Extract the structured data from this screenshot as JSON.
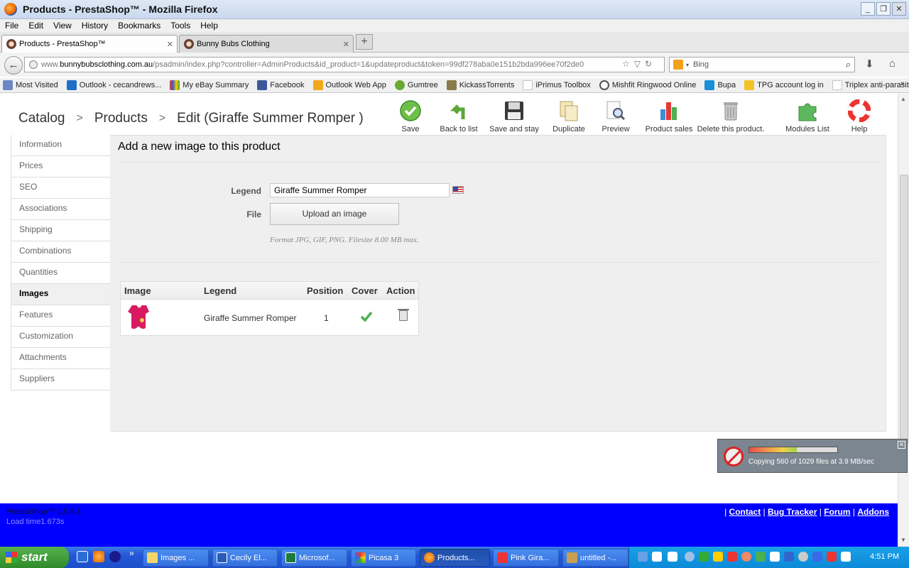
{
  "window": {
    "title": "Products - PrestaShop™ - Mozilla Firefox",
    "minimize": "_",
    "maximize": "❐",
    "close": "✕"
  },
  "menu": [
    "File",
    "Edit",
    "View",
    "History",
    "Bookmarks",
    "Tools",
    "Help"
  ],
  "tabs": [
    {
      "label": "Products - PrestaShop™",
      "active": true
    },
    {
      "label": "Bunny Bubs Clothing",
      "active": false
    }
  ],
  "new_tab": "+",
  "url": {
    "prefix": "www.",
    "domain": "bunnybubsclothing.com.au",
    "path": "/psadmin/index.php?controller=AdminProducts&id_product=1&updateproduct&token=99df278aba0e151b2bda996ee70f2de0"
  },
  "search": {
    "engine": "Bing"
  },
  "bookmarks": [
    "Most Visited",
    "Outlook - cecandrews...",
    "My eBay Summary",
    "Facebook",
    "Outlook Web App",
    "Gumtree",
    "KickassTorrents",
    "iPrimus Toolbox",
    "Mishfit Ringwood Online",
    "Bupa",
    "TPG account log in",
    "Triplex anti-parasite ti..."
  ],
  "breadcrumb": {
    "catalog": "Catalog",
    "products": "Products",
    "edit": "Edit (Giraffe Summer Romper )",
    "sep": ">"
  },
  "toolbar": [
    "Save",
    "Back to list",
    "Save and stay",
    "Duplicate",
    "Preview",
    "Product sales",
    "Delete this product.",
    "Modules List",
    "Help"
  ],
  "sidebar": [
    "Information",
    "Prices",
    "SEO",
    "Associations",
    "Shipping",
    "Combinations",
    "Quantities",
    "Images",
    "Features",
    "Customization",
    "Attachments",
    "Suppliers"
  ],
  "sidebar_active": "Images",
  "content": {
    "title": "Add a new image to this product",
    "legend_label": "Legend",
    "legend_value": "Giraffe Summer Romper",
    "file_label": "File",
    "upload_button": "Upload an image",
    "format_note": "Format JPG, GIF, PNG. Filesize 8.00 MB max."
  },
  "images_table": {
    "headers": [
      "Image",
      "Legend",
      "Position",
      "Cover",
      "Action"
    ],
    "rows": [
      {
        "legend": "Giraffe Summer Romper",
        "position": "1",
        "cover": true
      }
    ]
  },
  "footer": {
    "version": "PrestaShop™ 1.5.6.1",
    "load_time": "Load time1.673s",
    "links": [
      "Contact",
      "Bug Tracker",
      "Forum",
      "Addons"
    ]
  },
  "copy_toast": {
    "text": "Copying 560 of 1029 files at 3.9 MB/sec",
    "progress": 0.54,
    "close": "✕"
  },
  "taskbar": {
    "start": "start",
    "buttons": [
      "Images ...",
      "Cecily El...",
      "Microsof...",
      "Picasa 3",
      "Products...",
      "Pink Gira...",
      "untitled -..."
    ],
    "active_button": "Products...",
    "clock": "4:51 PM"
  }
}
